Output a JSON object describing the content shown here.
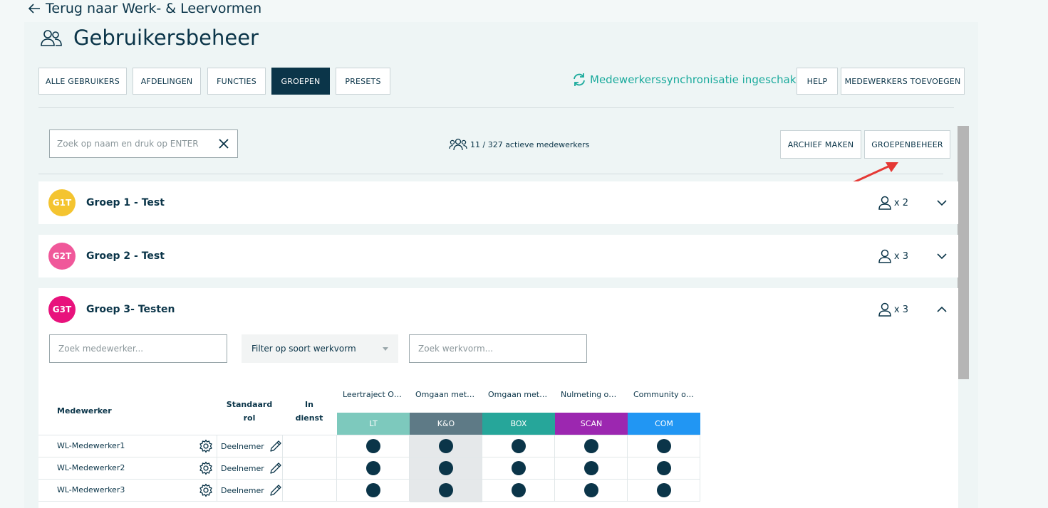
{
  "back_link": "Terug naar Werk- & Leervormen",
  "page_title": "Gebruikersbeheer",
  "tabs": [
    {
      "label": "ALLE GEBRUIKERS"
    },
    {
      "label": "AFDELINGEN"
    },
    {
      "label": "FUNCTIES"
    },
    {
      "label": "GROEPEN",
      "active": true
    },
    {
      "label": "PRESETS"
    }
  ],
  "sync_status": "Medewerkerssynchronisatie ingeschakeld",
  "help_label": "HELP",
  "add_employees_label": "MEDEWERKERS TOEVOEGEN",
  "search": {
    "placeholder": "Zoek op naam en druk op ENTER",
    "value": ""
  },
  "active_count": "11 / 327 actieve medewerkers",
  "archive_label": "ARCHIEF MAKEN",
  "group_management_label": "GROEPENBEHEER",
  "groups": [
    {
      "initials": "G1T",
      "name": "Groep 1 - Test",
      "members": "x 2",
      "color": "#f4c430",
      "expanded": false
    },
    {
      "initials": "G2T",
      "name": "Groep 2 - Test",
      "members": "x 3",
      "color": "#f0589a",
      "expanded": false
    },
    {
      "initials": "G3T",
      "name": "Groep 3- Testen",
      "members": "x 3",
      "color": "#e8127c",
      "expanded": true
    }
  ],
  "filters": {
    "employee_placeholder": "Zoek medewerker...",
    "type_select": "Filter op soort werkvorm",
    "workform_placeholder": "Zoek werkvorm..."
  },
  "table": {
    "col_employee": "Medewerker",
    "col_role_1": "Standaard",
    "col_role_2": "rol",
    "col_employed_1": "In",
    "col_employed_2": "dienst",
    "workforms": [
      {
        "title": "Leertraject Om...",
        "code": "LT",
        "color": "#7dc9bd"
      },
      {
        "title": "Omgaan met A...",
        "code": "K&O",
        "color": "#5e7a86"
      },
      {
        "title": "Omgaan met a...",
        "code": "BOX",
        "color": "#26a69a"
      },
      {
        "title": "Nulmeting omg...",
        "code": "SCAN",
        "color": "#9c27b0"
      },
      {
        "title": "Community om...",
        "code": "COM",
        "color": "#2196f3"
      }
    ],
    "rows": [
      {
        "name": "WL-Medewerker1",
        "role": "Deelnemer"
      },
      {
        "name": "WL-Medewerker2",
        "role": "Deelnemer"
      },
      {
        "name": "WL-Medewerker3",
        "role": "Deelnemer"
      }
    ]
  },
  "colors": {
    "primary": "#0b3549",
    "accent": "#1aaa9c",
    "annotation": "#e53935"
  }
}
